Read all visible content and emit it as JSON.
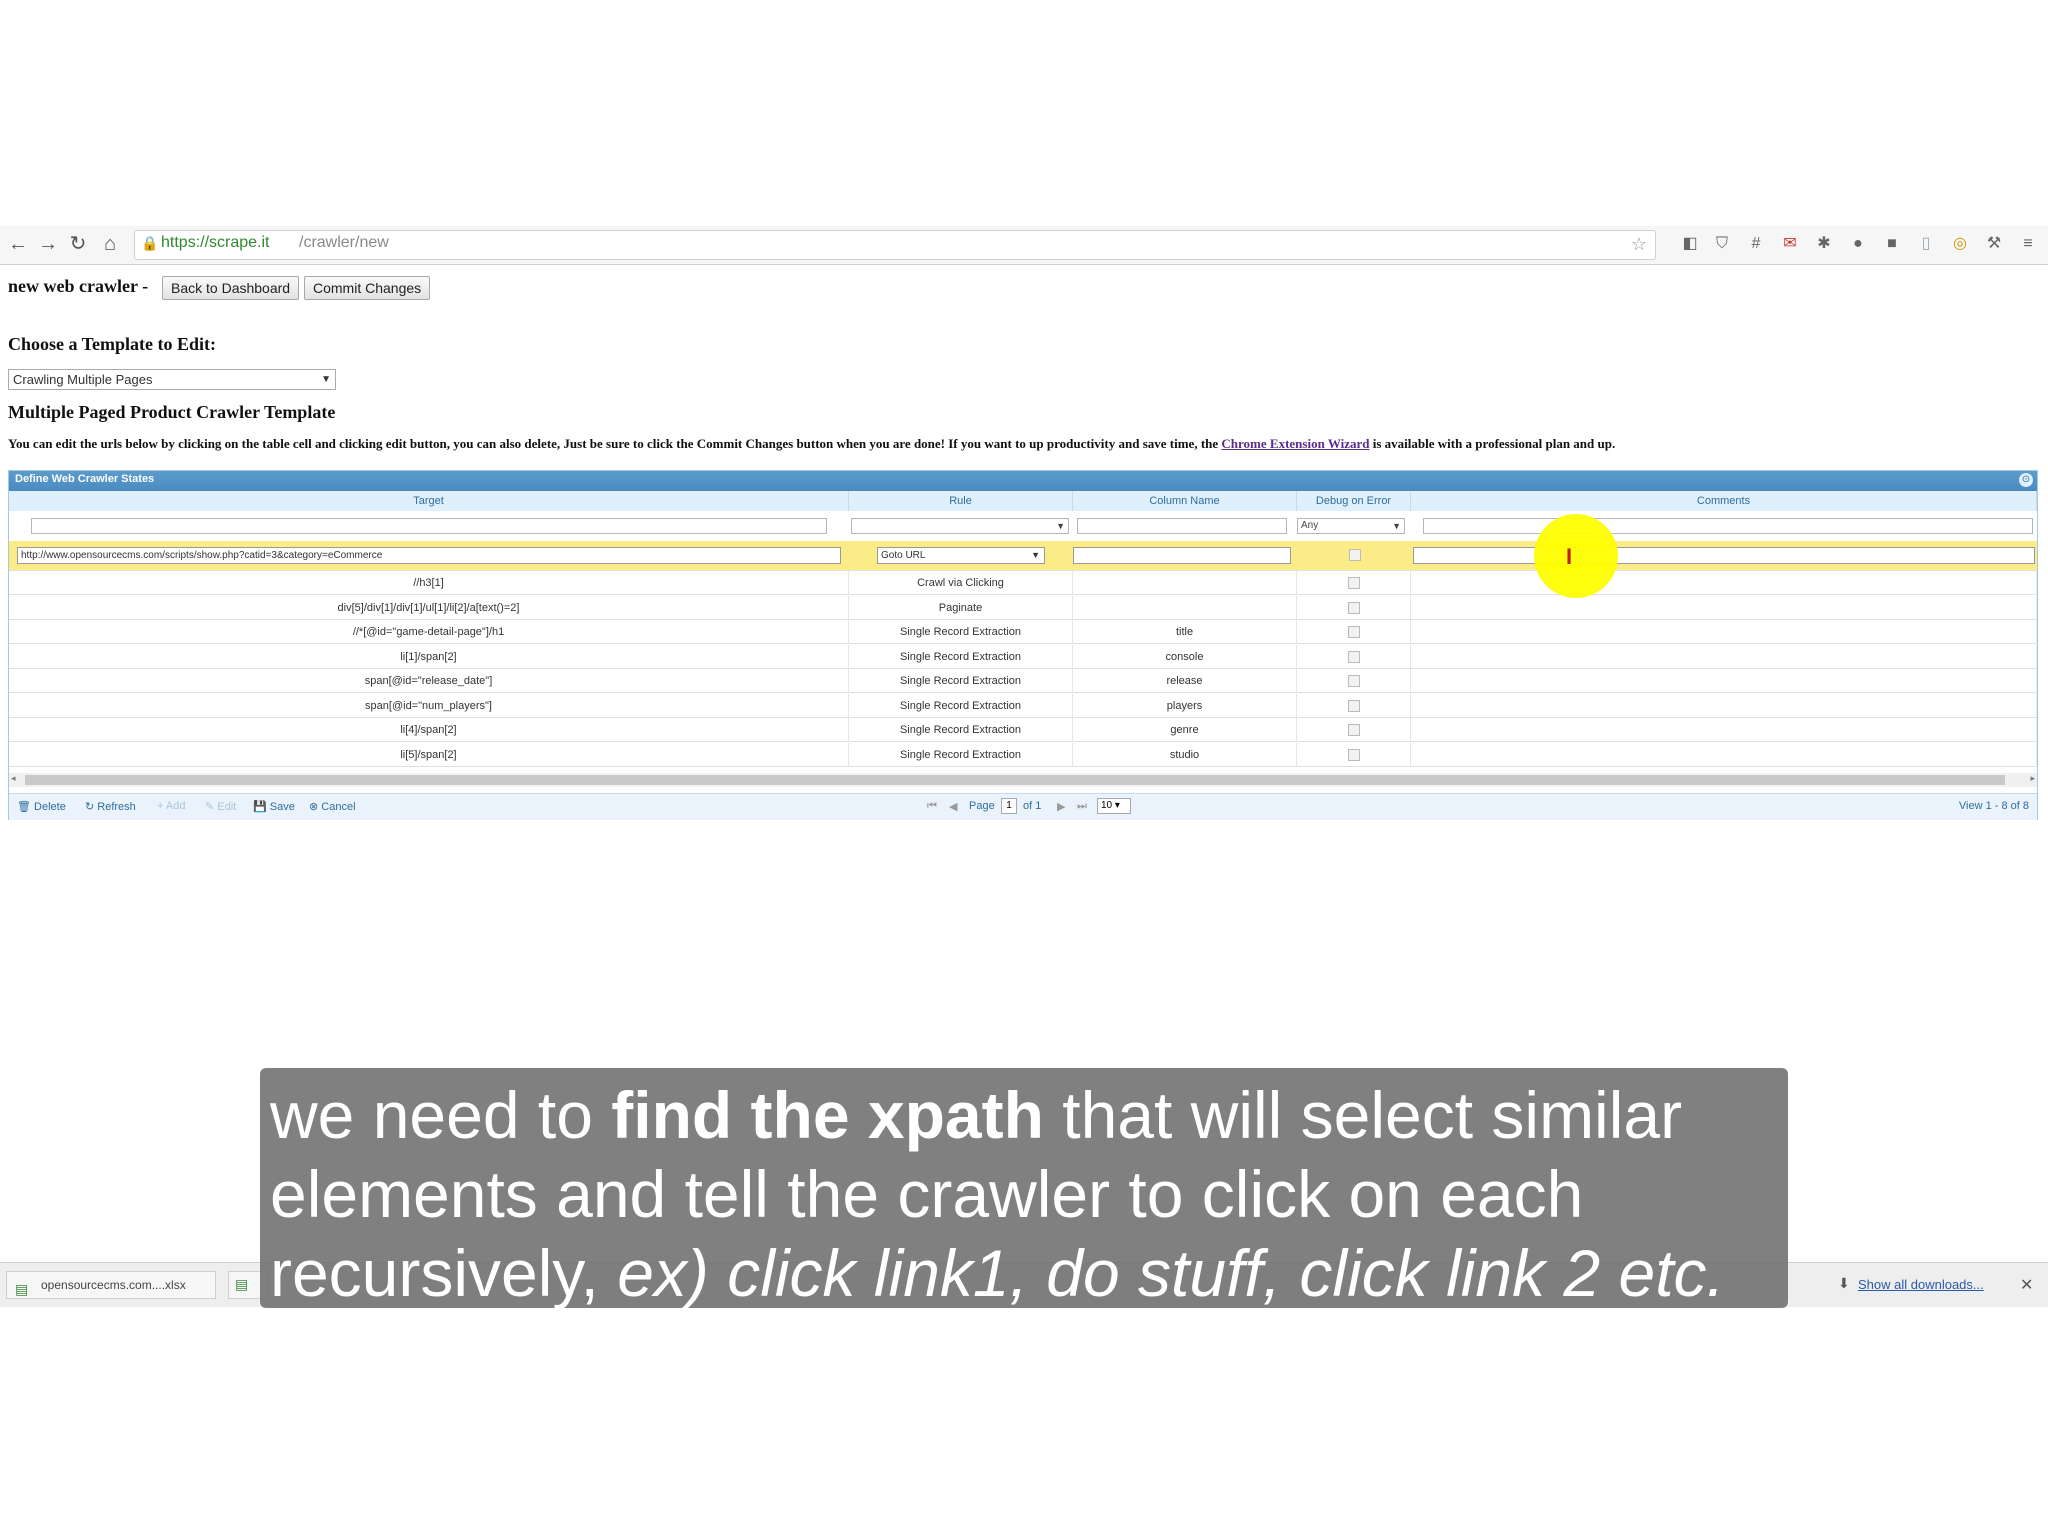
{
  "browser": {
    "url_scheme": "https://scrape.it",
    "url_path": "/crawler/new"
  },
  "page": {
    "header": "new web crawler -",
    "back_button": "Back to Dashboard",
    "commit_button": "Commit Changes",
    "choose_label": "Choose a Template to Edit:",
    "template_selected": "Crawling Multiple Pages",
    "template_title": "Multiple Paged Product Crawler Template",
    "instructions_before": "You can edit the urls below by clicking on the table cell and clicking edit button, you can also delete, Just be sure to click the Commit Changes button when you are done! If you want to up productivity and save time, the ",
    "instructions_link": "Chrome Extension Wizard",
    "instructions_after": " is available with a professional plan and up."
  },
  "grid": {
    "title": "Define Web Crawler States",
    "columns": [
      "Target",
      "Rule",
      "Column Name",
      "Debug on Error",
      "Comments"
    ],
    "filter_debug": "Any",
    "edit_row": {
      "target": "http://www.opensourcecms.com/scripts/show.php?catid=3&category=eCommerce",
      "rule": "Goto URL"
    },
    "rows": [
      {
        "target": "//h3[1]",
        "rule": "Crawl via Clicking",
        "column": ""
      },
      {
        "target": "div[5]/div[1]/div[1]/ul[1]/li[2]/a[text()=2]",
        "rule": "Paginate",
        "column": ""
      },
      {
        "target": "//*[@id=\"game-detail-page\"]/h1",
        "rule": "Single Record Extraction",
        "column": "title"
      },
      {
        "target": "li[1]/span[2]",
        "rule": "Single Record Extraction",
        "column": "console"
      },
      {
        "target": "span[@id=\"release_date\"]",
        "rule": "Single Record Extraction",
        "column": "release"
      },
      {
        "target": "span[@id=\"num_players\"]",
        "rule": "Single Record Extraction",
        "column": "players"
      },
      {
        "target": "li[4]/span[2]",
        "rule": "Single Record Extraction",
        "column": "genre"
      },
      {
        "target": "li[5]/span[2]",
        "rule": "Single Record Extraction",
        "column": "studio"
      }
    ],
    "pager": {
      "delete": "Delete",
      "refresh": "Refresh",
      "add": "Add",
      "edit": "Edit",
      "save": "Save",
      "cancel": "Cancel",
      "page_label": "Page",
      "page_value": "1",
      "of_label": "of 1",
      "rows_per_page": "10",
      "view_info": "View 1 - 8 of 8"
    }
  },
  "downloads": {
    "item": "opensourcecms.com....xlsx",
    "show_all": "Show all downloads..."
  },
  "caption": {
    "part1": "we need to ",
    "bold": "find the xpath",
    "part2": " that will select similar",
    "line2": "elements and tell the crawler to click on each",
    "line3_normal": "recursively, ",
    "line3_italic": "ex) click link1, do stuff, click link 2 etc."
  },
  "colors": {
    "grid_header": "#5c9ccc",
    "edit_row": "#fbec88",
    "cursor_highlight": "#ffff00"
  }
}
